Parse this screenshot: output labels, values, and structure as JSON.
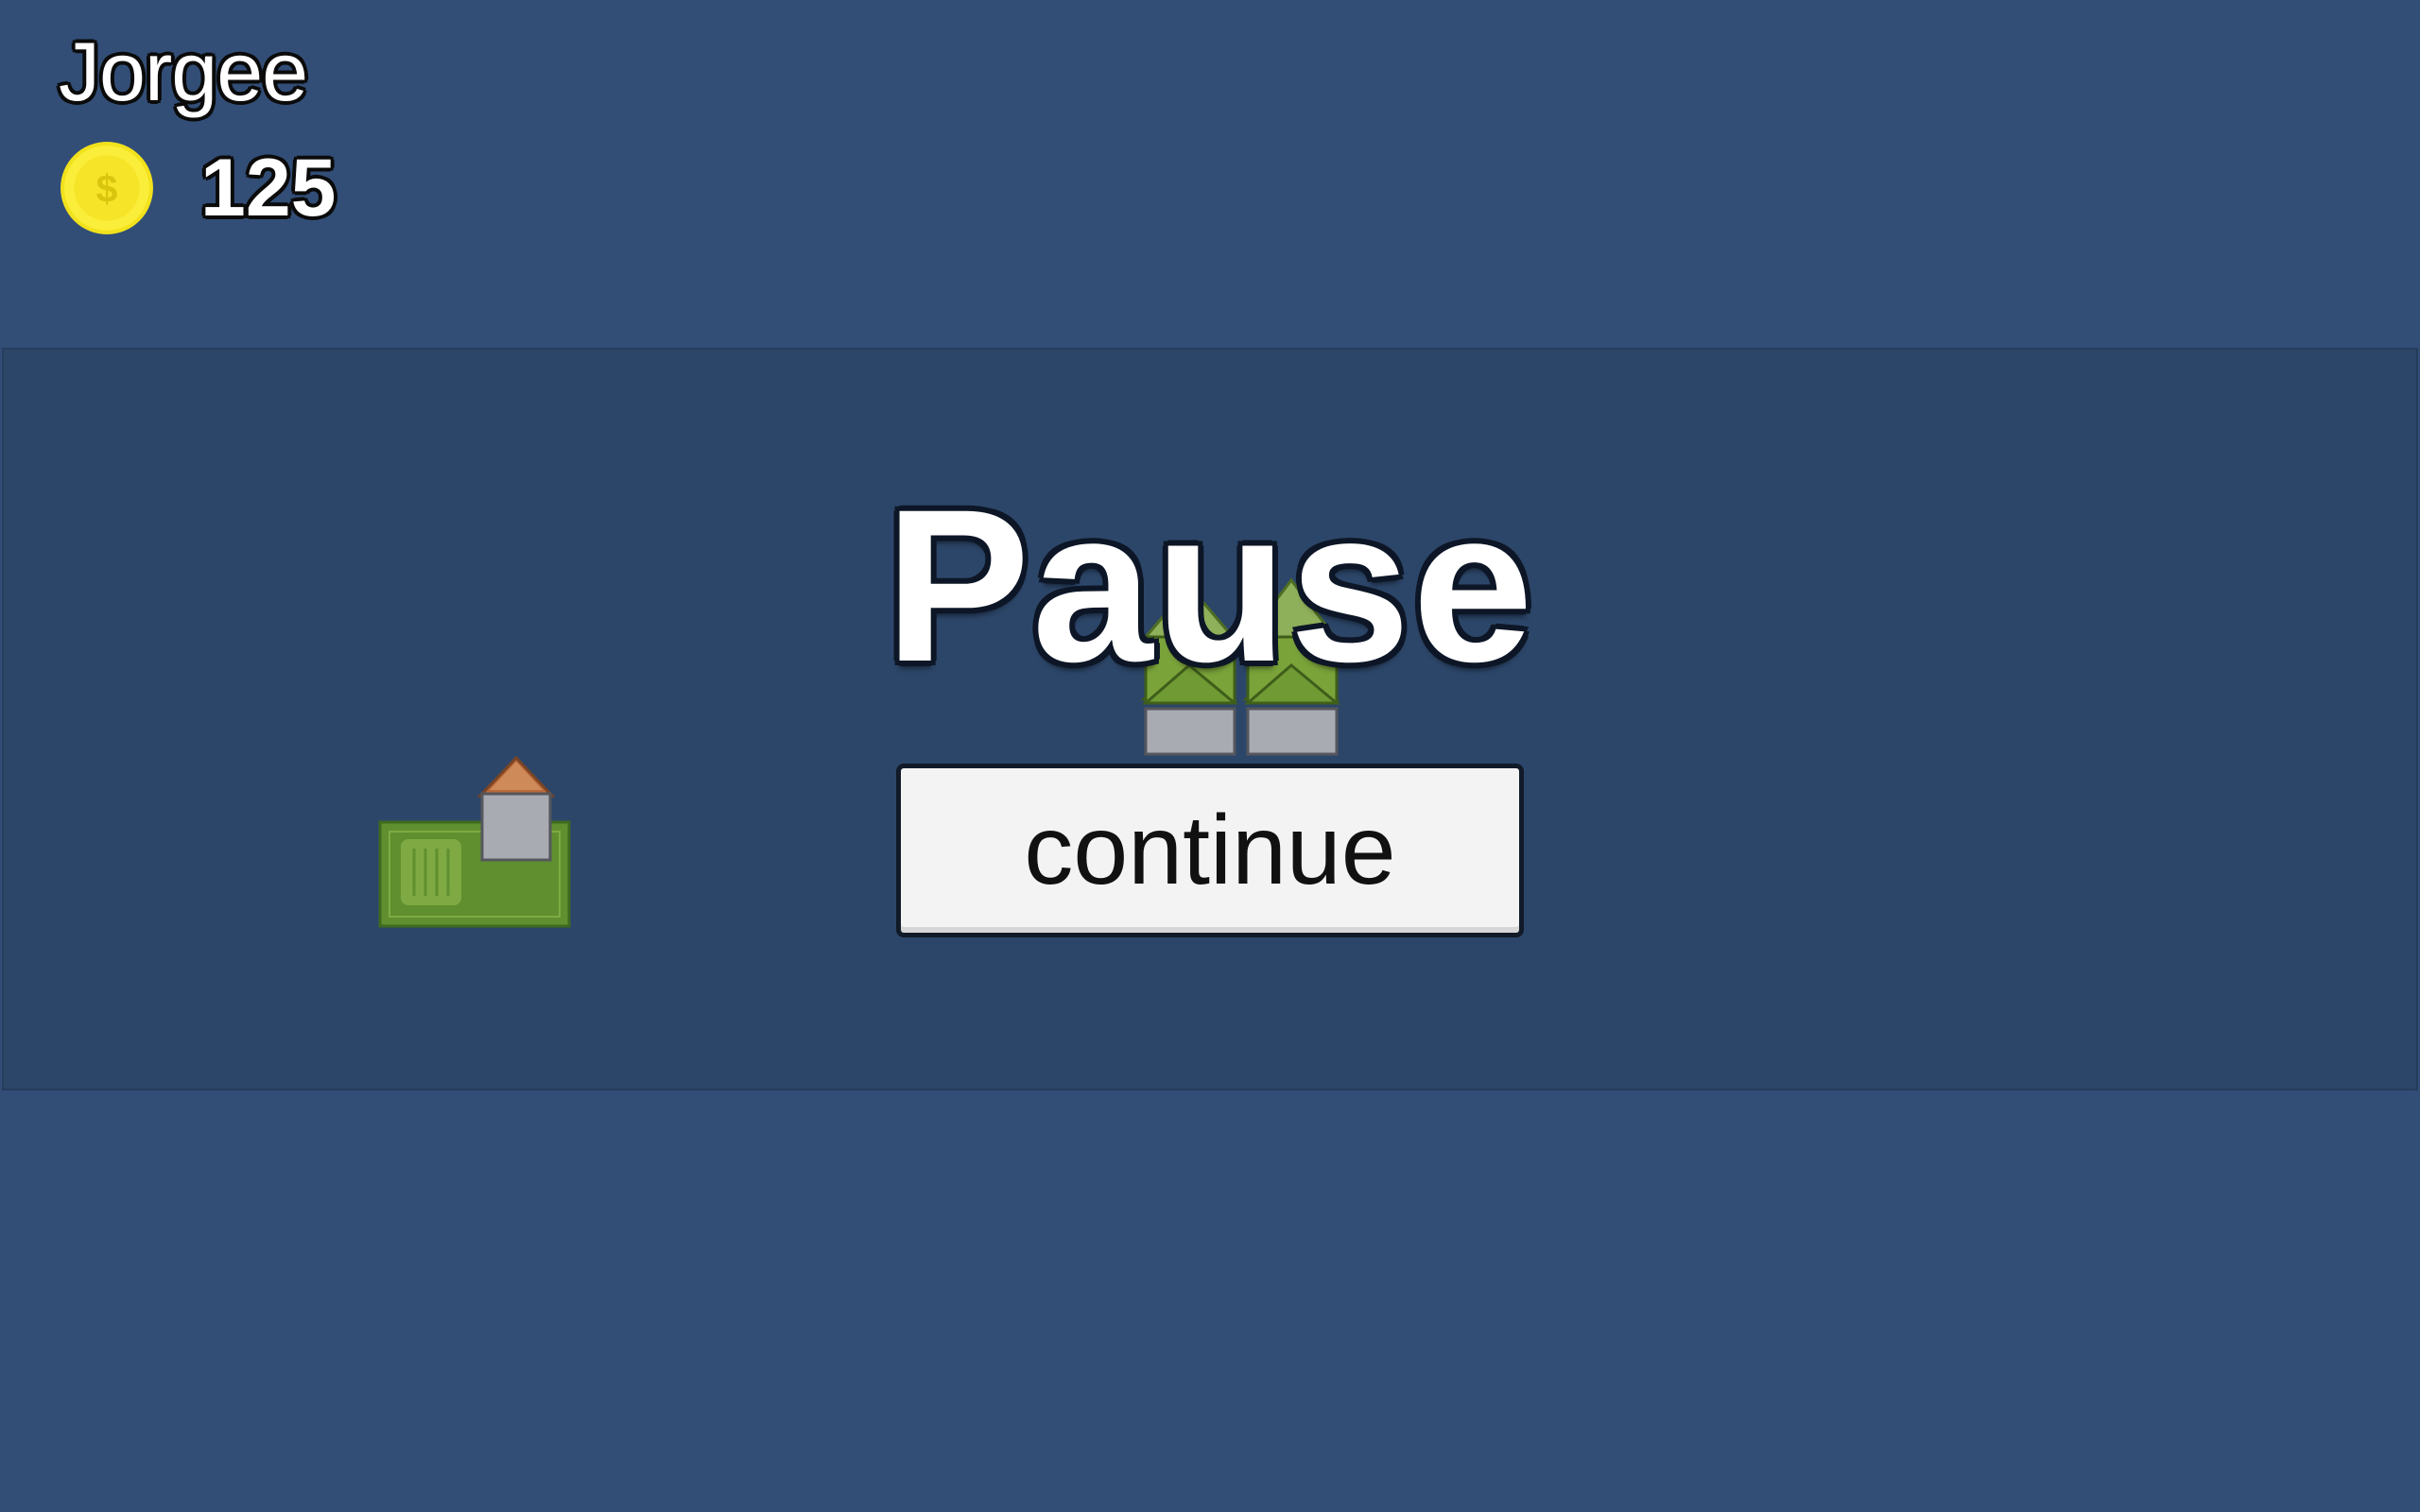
{
  "hud": {
    "player_name": "Jorgee",
    "coins": "125",
    "coin_icon": "coin-dollar-icon"
  },
  "pause_menu": {
    "title": "Pause",
    "continue_label": "continue"
  },
  "colors": {
    "background": "#324e77",
    "panel": "#2c4669",
    "coin": "#f5e623",
    "grass": "#5f8f2f",
    "roof": "#b8683a"
  }
}
